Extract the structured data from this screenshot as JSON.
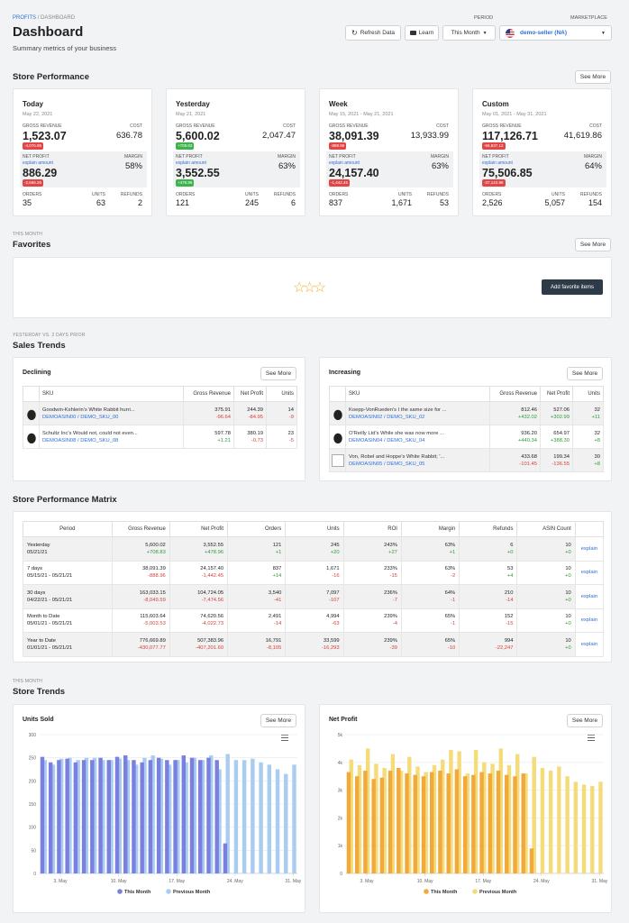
{
  "breadcrumb": {
    "root": "PROFITS",
    "sep": "/",
    "current": "DASHBOARD"
  },
  "title": "Dashboard",
  "subtitle": "Summary metrics of your business",
  "header": {
    "refresh": "Refresh Data",
    "learn": "Learn",
    "period_label": "PERIOD",
    "period": "This Month",
    "marketplace_label": "MARKETPLACE",
    "marketplace": "demo-seller (NA)"
  },
  "store_performance": {
    "title": "Store Performance",
    "see_more": "See More",
    "cards": [
      {
        "title": "Today",
        "date": "May 22, 2021",
        "gross_revenue": "1,523.07",
        "gr_delta": "-4,076.95",
        "cost": "636.78",
        "net_profit": "886.29",
        "np_delta": "-2,666.26",
        "margin": "58%",
        "orders": "35",
        "units": "63",
        "refunds": "2",
        "gr_up": false,
        "np_up": false
      },
      {
        "title": "Yesterday",
        "date": "May 21, 2021",
        "gross_revenue": "5,600.02",
        "gr_delta": "+708.83",
        "cost": "2,047.47",
        "net_profit": "3,552.55",
        "np_delta": "+478.96",
        "margin": "63%",
        "orders": "121",
        "units": "245",
        "refunds": "6",
        "gr_up": true,
        "np_up": true
      },
      {
        "title": "Week",
        "date": "May 15, 2021 - May 21, 2021",
        "gross_revenue": "38,091.39",
        "gr_delta": "-888.96",
        "cost": "13,933.99",
        "net_profit": "24,157.40",
        "np_delta": "-1,442.45",
        "margin": "63%",
        "orders": "837",
        "units": "1,671",
        "refunds": "53",
        "gr_up": false,
        "np_up": false
      },
      {
        "title": "Custom",
        "date": "May 01, 2021 - May 31, 2021",
        "gross_revenue": "117,126.71",
        "gr_delta": "-56,837.12",
        "cost": "41,619.86",
        "net_profit": "75,506.85",
        "np_delta": "-37,143.88",
        "margin": "64%",
        "orders": "2,526",
        "units": "5,057",
        "refunds": "154",
        "gr_up": false,
        "np_up": false
      }
    ],
    "labels": {
      "gross_revenue": "GROSS REVENUE",
      "cost": "COST",
      "net_profit": "NET PROFIT",
      "explain": "explain amount",
      "margin": "MARGIN",
      "orders": "ORDERS",
      "units": "UNITS",
      "refunds": "REFUNDS"
    }
  },
  "favorites": {
    "eyebrow": "THIS MONTH",
    "title": "Favorites",
    "see_more": "See More",
    "add": "Add favorite items"
  },
  "sales_trends": {
    "eyebrow": "YESTERDAY VS. 2 DAYS PRIOR",
    "title": "Sales Trends",
    "columns": [
      "SKU",
      "Gross Revenue",
      "Net Profit",
      "Units"
    ],
    "declining": {
      "title": "Declining",
      "see_more": "See More",
      "rows": [
        {
          "name": "Goodwin-Kshlerin's White Rabbit hurri...",
          "sku": "DEMOASIN00 / DEMO_SKU_00",
          "gr": "375.91",
          "gr_d": "-96.64",
          "np": "244.39",
          "np_d": "-84.95",
          "u": "14",
          "u_d": "-9"
        },
        {
          "name": "Schultz Inc's Would not, could not even...",
          "sku": "DEMOASIN08 / DEMO_SKU_08",
          "gr": "597.78",
          "gr_d": "+1.21",
          "np": "380.19",
          "np_d": "-0.73",
          "u": "23",
          "u_d": "-5"
        }
      ]
    },
    "increasing": {
      "title": "Increasing",
      "see_more": "See More",
      "rows": [
        {
          "name": "Koepp-VonRueden's I the same size for ...",
          "sku": "DEMOASIN02 / DEMO_SKU_02",
          "gr": "812.46",
          "gr_d": "+432.02",
          "np": "527.06",
          "np_d": "+302.99",
          "u": "32",
          "u_d": "+11"
        },
        {
          "name": "O'Reilly Ltd's While she was now more ...",
          "sku": "DEMOASIN04 / DEMO_SKU_04",
          "gr": "936.20",
          "gr_d": "+440.34",
          "np": "654.97",
          "np_d": "+388.30",
          "u": "32",
          "u_d": "+8"
        },
        {
          "name": "Von, Robel and Hoppe's White Rabbit; '...",
          "sku": "DEMOASIN05 / DEMO_SKU_05",
          "gr": "433.68",
          "gr_d": "-101.45",
          "np": "199.34",
          "np_d": "-136.55",
          "u": "30",
          "u_d": "+8"
        }
      ]
    }
  },
  "matrix": {
    "title": "Store Performance Matrix",
    "columns": [
      "Period",
      "Gross Revenue",
      "Net Profit",
      "Orders",
      "Units",
      "ROI",
      "Margin",
      "Refunds",
      "ASIN Count",
      ""
    ],
    "explain": "explain",
    "rows": [
      {
        "period": "Yesterday",
        "dates": "05/21/21",
        "gr": "5,600.02",
        "gr_d": "+708.83",
        "np": "3,552.55",
        "np_d": "+478.96",
        "o": "121",
        "o_d": "+1",
        "u": "245",
        "u_d": "+20",
        "roi": "243%",
        "roi_d": "+27",
        "m": "63%",
        "m_d": "+1",
        "r": "6",
        "r_d": "+0",
        "a": "10",
        "a_d": "+0"
      },
      {
        "period": "7 days",
        "dates": "05/15/21 - 05/21/21",
        "gr": "38,091.39",
        "gr_d": "-888.96",
        "np": "24,157.40",
        "np_d": "-1,442.45",
        "o": "837",
        "o_d": "+14",
        "u": "1,671",
        "u_d": "-16",
        "roi": "233%",
        "roi_d": "-15",
        "m": "63%",
        "m_d": "-2",
        "r": "53",
        "r_d": "+4",
        "a": "10",
        "a_d": "+0"
      },
      {
        "period": "30 days",
        "dates": "04/22/21 - 05/21/21",
        "gr": "163,033.15",
        "gr_d": "-8,049.59",
        "np": "104,724.05",
        "np_d": "-7,474.56",
        "o": "3,540",
        "o_d": "-41",
        "u": "7,097",
        "u_d": "-107",
        "roi": "236%",
        "roi_d": "-7",
        "m": "64%",
        "m_d": "-1",
        "r": "210",
        "r_d": "-14",
        "a": "10",
        "a_d": "+0"
      },
      {
        "period": "Month to Date",
        "dates": "05/01/21 - 05/21/21",
        "gr": "115,603.64",
        "gr_d": "-5,003.53",
        "np": "74,620.56",
        "np_d": "-4,022.73",
        "o": "2,491",
        "o_d": "-14",
        "u": "4,994",
        "u_d": "-63",
        "roi": "239%",
        "roi_d": "-4",
        "m": "65%",
        "m_d": "-1",
        "r": "152",
        "r_d": "-15",
        "a": "10",
        "a_d": "+0"
      },
      {
        "period": "Year to Date",
        "dates": "01/01/21 - 05/21/21",
        "gr": "776,669.89",
        "gr_d": "-430,077.77",
        "np": "507,383.96",
        "np_d": "-407,201.60",
        "o": "16,791",
        "o_d": "-8,105",
        "u": "33,599",
        "u_d": "-16,293",
        "roi": "239%",
        "roi_d": "-39",
        "m": "65%",
        "m_d": "-10",
        "r": "994",
        "r_d": "-22,247",
        "a": "10",
        "a_d": "+0"
      }
    ]
  },
  "store_trends": {
    "eyebrow": "THIS MONTH",
    "title": "Store Trends",
    "see_more": "See More"
  },
  "colors": {
    "units_this": "#7b7fe0",
    "units_prev": "#a9cdf0",
    "np_this": "#f0a93a",
    "np_prev": "#f4dc7a",
    "accent": "#2f6fd6"
  },
  "chart_data": [
    {
      "type": "bar",
      "title": "Units Sold",
      "yticks": [
        "0",
        "50",
        "100",
        "150",
        "200",
        "250",
        "300"
      ],
      "ylim": [
        0,
        300
      ],
      "xticks": [
        "3. May",
        "10. May",
        "17. May",
        "24. May",
        "31. May"
      ],
      "legend": [
        "This Month",
        "Previous Month"
      ],
      "series": [
        {
          "name": "This Month",
          "values": [
            252,
            240,
            245,
            248,
            240,
            245,
            245,
            250,
            245,
            252,
            255,
            245,
            240,
            245,
            250,
            245,
            245,
            255,
            250,
            245,
            250,
            245,
            65
          ]
        },
        {
          "name": "Previous Month",
          "values": [
            245,
            235,
            248,
            250,
            245,
            250,
            250,
            245,
            245,
            248,
            245,
            235,
            250,
            255,
            248,
            235,
            245,
            240,
            250,
            245,
            255,
            225,
            258,
            245,
            245,
            248,
            240,
            235,
            225,
            215,
            235
          ]
        }
      ]
    },
    {
      "type": "bar",
      "title": "Net Profit",
      "yticks": [
        "0",
        "1k",
        "2k",
        "3k",
        "4k",
        "5k"
      ],
      "ylim": [
        0,
        5000
      ],
      "xticks": [
        "3. May",
        "10. May",
        "17. May",
        "24. May",
        "31. May"
      ],
      "legend": [
        "This Month",
        "Previous Month"
      ],
      "series": [
        {
          "name": "This Month",
          "values": [
            3650,
            3500,
            3700,
            3400,
            3450,
            3700,
            3800,
            3600,
            3550,
            3500,
            3650,
            3700,
            3600,
            3750,
            3500,
            3550,
            3650,
            3600,
            3700,
            3550,
            3500,
            3600,
            900
          ]
        },
        {
          "name": "Previous Month",
          "values": [
            4100,
            3900,
            4500,
            3950,
            3800,
            4300,
            3700,
            4200,
            3850,
            3650,
            3900,
            4100,
            4450,
            4400,
            3600,
            4450,
            4000,
            3950,
            4500,
            3900,
            4300,
            3600,
            4200,
            3800,
            3700,
            3850,
            3500,
            3300,
            3200,
            3150,
            3300
          ]
        }
      ]
    }
  ]
}
